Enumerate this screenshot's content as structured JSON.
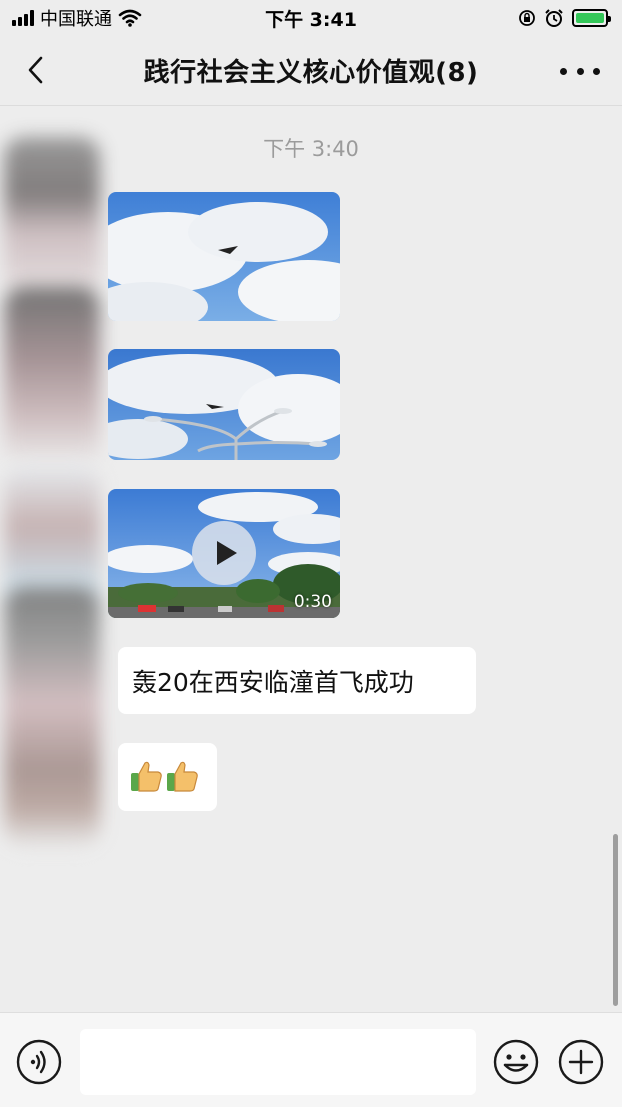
{
  "status_bar": {
    "carrier": "中国联通",
    "time": "下午 3:41"
  },
  "nav": {
    "title": "践行社会主义核心价值观(8)"
  },
  "chat": {
    "timestamp": "下午 3:40",
    "video_duration": "0:30",
    "messages": [
      {
        "type": "text",
        "text": "轰20在西安临潼首飞成功"
      },
      {
        "type": "emoji",
        "text": "👍👍"
      }
    ]
  },
  "input_bar": {
    "placeholder": ""
  },
  "icons": {
    "back": "chevron-left-icon",
    "more": "more-dots-icon",
    "voice": "voice-icon",
    "emoji": "smiley-icon",
    "plus": "plus-icon",
    "play": "play-icon"
  },
  "colors": {
    "background": "#ededed",
    "bubble": "#ffffff",
    "battery": "#34c759",
    "timestamp": "#9b9b9b"
  }
}
